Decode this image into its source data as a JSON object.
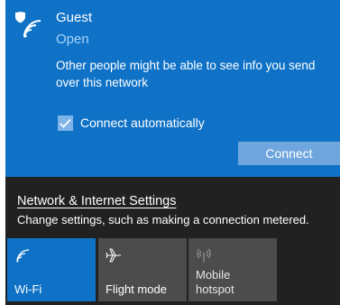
{
  "network": {
    "name": "Guest",
    "status": "Open",
    "warning": "Other people might be able to see info you send over this network",
    "connect_automatically_label": "Connect automatically",
    "connect_automatically_checked": true,
    "connect_button_label": "Connect"
  },
  "settings": {
    "link_label": "Network & Internet Settings",
    "description": "Change settings, such as making a connection metered."
  },
  "quick_actions": [
    {
      "label": "Wi-Fi",
      "icon": "wifi-icon",
      "active": true
    },
    {
      "label": "Flight mode",
      "icon": "airplane-icon",
      "active": false
    },
    {
      "label": "Mobile hotspot",
      "icon": "hotspot-icon",
      "active": false,
      "disabled": true
    }
  ],
  "colors": {
    "accent": "#0f72c6",
    "flyout_background": "#212121",
    "tile_inactive": "#4c4c4c",
    "connect_button": "#6fa6dd",
    "status_text": "#a9d3fb"
  }
}
